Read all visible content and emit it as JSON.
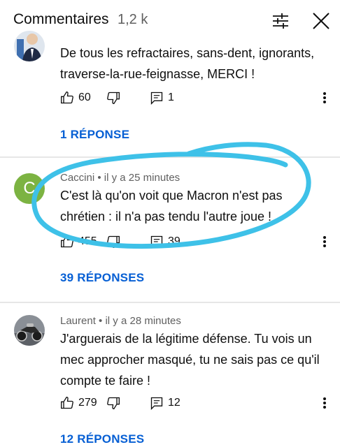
{
  "header": {
    "title": "Commentaires",
    "count": "1,2 k"
  },
  "colors": {
    "link": "#065fd4",
    "highlight_circle": "#3ec1e8",
    "avatar_c": "#7cb342"
  },
  "comments": [
    {
      "text_lines": [
        "De tous les refractaires, sans-dent, ignorants,",
        "traverse-la-rue-feignasse, MERCI !"
      ],
      "likes": "60",
      "replies_count": "1",
      "replies_label": "1 RÉPONSE"
    },
    {
      "avatar_letter": "C",
      "author": "Caccini",
      "time": "il y a 25 minutes",
      "text_lines": [
        "C'est là qu'on voit que Macron n'est pas",
        "chrétien : il n'a pas tendu l'autre joue !"
      ],
      "likes": "455",
      "replies_count": "39",
      "replies_label": "39 RÉPONSES"
    },
    {
      "author": "Laurent",
      "time": "il y a 28 minutes",
      "text_lines": [
        "J'arguerais de la légitime défense. Tu vois un",
        "mec approcher masqué, tu ne sais pas ce qu'il",
        "compte te faire !"
      ],
      "likes": "279",
      "replies_count": "12",
      "replies_label": "12 RÉPONSES"
    }
  ]
}
